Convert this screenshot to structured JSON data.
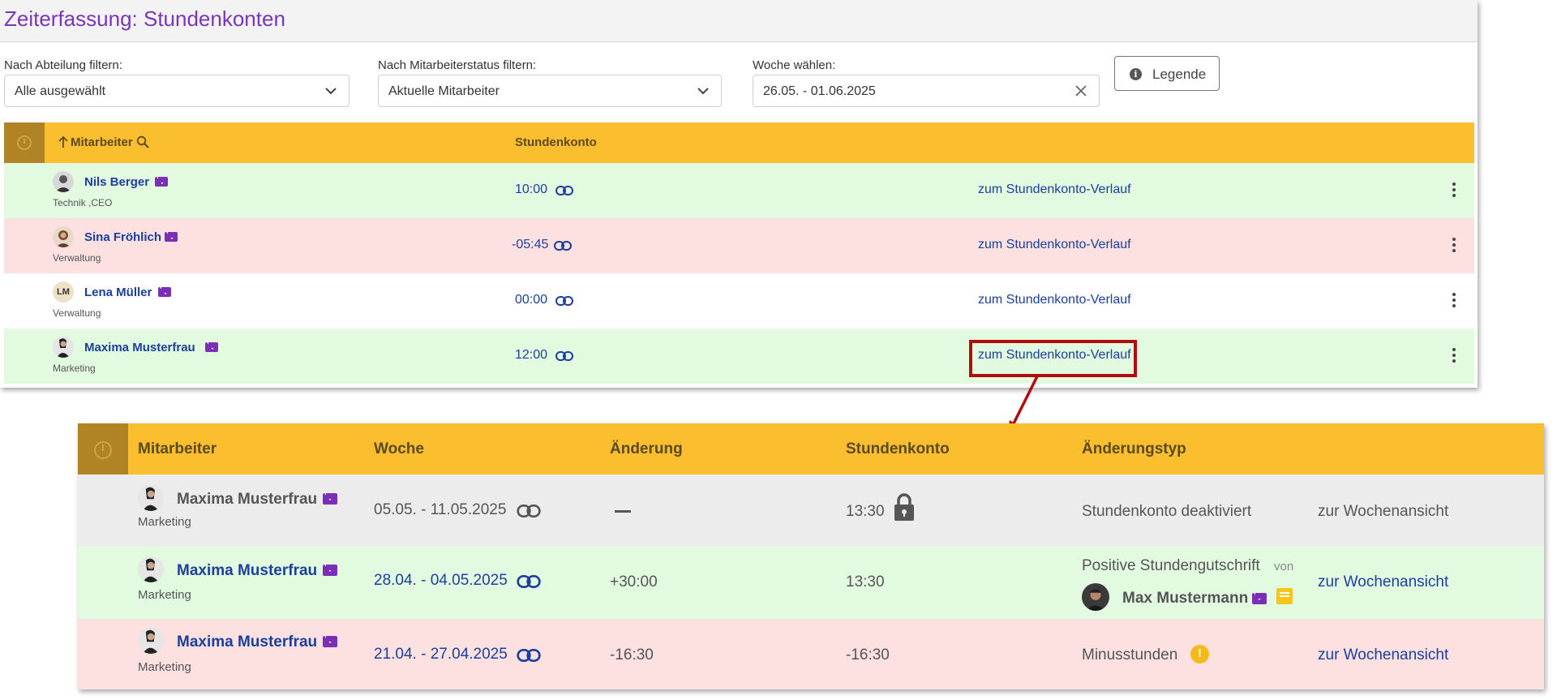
{
  "page_title": "Zeiterfassung: Stundenkonten",
  "filters": {
    "department": {
      "label": "Nach Abteilung filtern:",
      "value": "Alle ausgewählt"
    },
    "status": {
      "label": "Nach Mitarbeiterstatus filtern:",
      "value": "Aktuelle Mitarbeiter"
    },
    "week": {
      "label": "Woche wählen:",
      "value": "26.05. - 01.06.2025"
    },
    "legend_button": "Legende"
  },
  "table1": {
    "headers": {
      "employee": "Mitarbeiter",
      "account": "Stundenkonto"
    },
    "rows": [
      {
        "name": "Nils Berger",
        "dept": "Technik ,CEO",
        "hours": "10:00",
        "link": "zum Stundenkonto-Verlauf",
        "bg": "#e2fbe0"
      },
      {
        "name": "Sina Fröhlich",
        "dept": "Verwaltung",
        "hours": "-05:45",
        "link": "zum Stundenkonto-Verlauf",
        "bg": "#fde1e1"
      },
      {
        "name": "Lena Müller",
        "initials": "LM",
        "dept": "Verwaltung",
        "hours": "00:00",
        "link": "zum Stundenkonto-Verlauf",
        "bg": "#ffffff"
      },
      {
        "name": "Maxima Musterfrau",
        "dept": "Marketing",
        "hours": "12:00",
        "link": "zum Stundenkonto-Verlauf",
        "bg": "#e2fbe0"
      }
    ]
  },
  "table2": {
    "headers": {
      "employee": "Mitarbeiter",
      "week": "Woche",
      "change": "Änderung",
      "account": "Stundenkonto",
      "change_type": "Änderungstyp"
    },
    "rows": [
      {
        "name": "Maxima Musterfrau",
        "dept": "Marketing",
        "week": "05.05. - 11.05.2025",
        "change": "",
        "account": "13:30",
        "type": "Stundenkonto deaktiviert",
        "link": "zur Wochenansicht",
        "bg": "#ececec"
      },
      {
        "name": "Maxima Musterfrau",
        "dept": "Marketing",
        "week": "28.04. - 04.05.2025",
        "change": "+30:00",
        "account": "13:30",
        "type": "Positive Stundengutschrift",
        "type_suffix": "von",
        "by_user": "Max Mustermann",
        "link": "zur Wochenansicht",
        "bg": "#e2fbe0"
      },
      {
        "name": "Maxima Musterfrau",
        "dept": "Marketing",
        "week": "21.04. - 27.04.2025",
        "change": "-16:30",
        "account": "-16:30",
        "type": "Minusstunden",
        "link": "zur Wochenansicht",
        "bg": "#fde1e1"
      }
    ]
  },
  "colors": {
    "header": "#fbbe2e",
    "header_corner": "#b08424",
    "title": "#7a35b8",
    "link": "#1c3f9c",
    "mail": "#7a2fb6",
    "highlight": "#b00e0e"
  }
}
